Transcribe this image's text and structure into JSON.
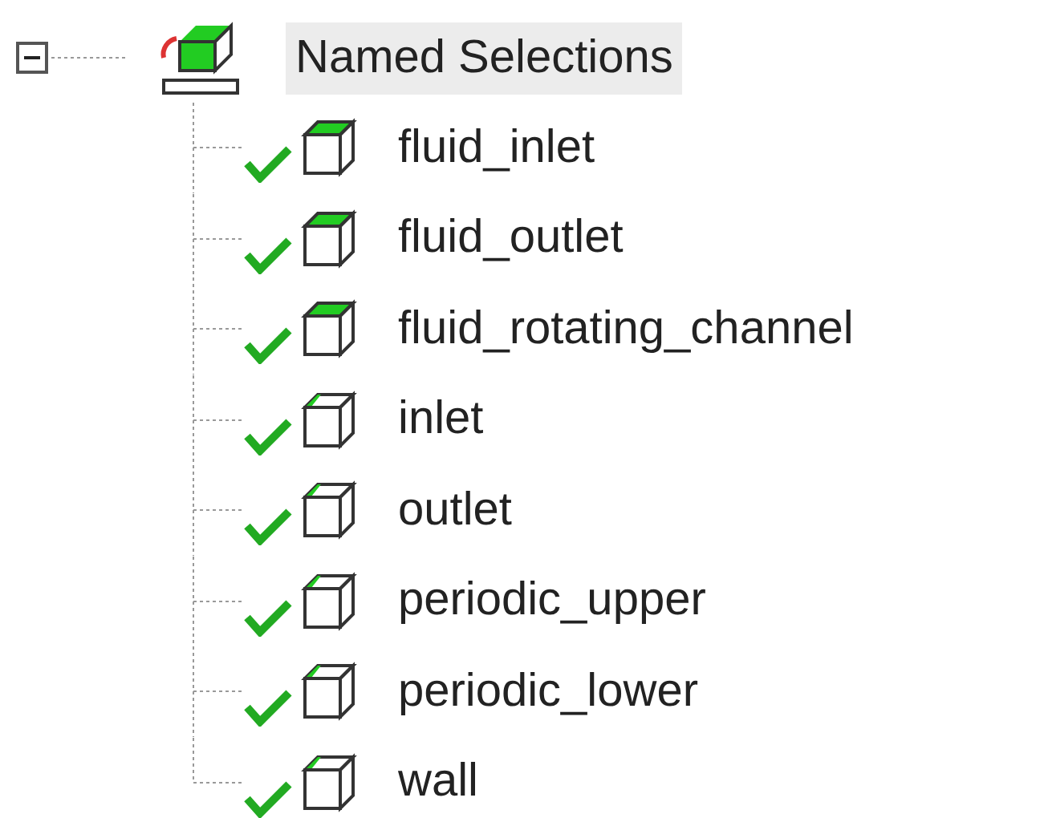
{
  "tree": {
    "label": "Named Selections",
    "expanded": true,
    "selected": true,
    "children": [
      {
        "label": "fluid_inlet",
        "kind": "body",
        "checked": true
      },
      {
        "label": "fluid_outlet",
        "kind": "body",
        "checked": true
      },
      {
        "label": "fluid_rotating_channel",
        "kind": "body",
        "checked": true
      },
      {
        "label": "inlet",
        "kind": "face",
        "checked": true
      },
      {
        "label": "outlet",
        "kind": "face",
        "checked": true
      },
      {
        "label": "periodic_upper",
        "kind": "face",
        "checked": true
      },
      {
        "label": "periodic_lower",
        "kind": "face",
        "checked": true
      },
      {
        "label": "wall",
        "kind": "face",
        "checked": true
      }
    ]
  }
}
